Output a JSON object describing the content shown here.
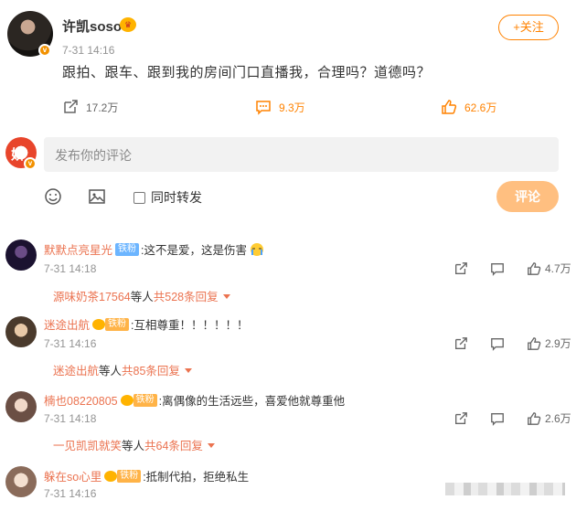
{
  "post": {
    "author": "许凯soso",
    "time": "7-31 14:16",
    "follow_label": "+关注",
    "text": "跟拍、跟车、跟到我的房间门口直播我，合理吗？道德吗？",
    "reposts": "17.2万",
    "comments": "9.3万",
    "likes": "62.6万"
  },
  "composer": {
    "placeholder": "发布你的评论",
    "sametime_label": "同时转发",
    "submit_label": "评论"
  },
  "comments": [
    {
      "user": "默默点亮星光",
      "badge": "铁粉",
      "text": ":这不是爱，这是伤害",
      "time": "7-31 14:18",
      "likes": "4.7万",
      "reply_user": "源味奶茶17564",
      "reply_mid": " 等人 ",
      "reply_count": "共528条回复"
    },
    {
      "user": "迷途出航",
      "badge": "铁粉",
      "text": ":互相尊重！！！！！！",
      "time": "7-31 14:16",
      "likes": "2.9万",
      "reply_user": "迷途出航",
      "reply_mid": " 等人 ",
      "reply_count": "共85条回复"
    },
    {
      "user": "楠也08220805",
      "badge": "铁粉",
      "text": ":离偶像的生活远些，喜爱他就尊重他",
      "time": "7-31 14:18",
      "likes": "2.6万",
      "reply_user": "一见凯凯就笑",
      "reply_mid": " 等人 ",
      "reply_count": "共64条回复"
    },
    {
      "user": "躲在so心里",
      "badge": "铁粉",
      "text": ":抵制代拍，拒绝私生",
      "time": "7-31 14:16"
    }
  ],
  "colors": {
    "accent": "#ff8200",
    "username": "#eb7350",
    "submit_bg": "#ffbf80"
  }
}
